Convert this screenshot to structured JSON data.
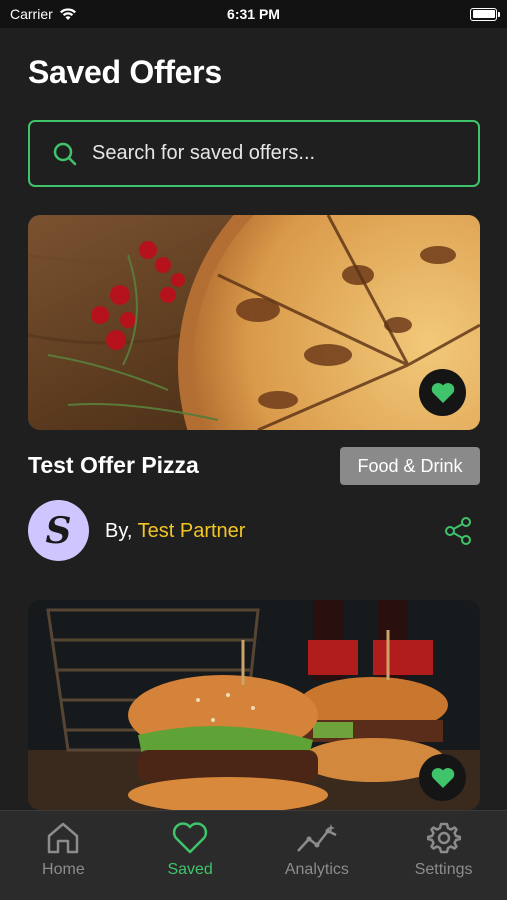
{
  "status_bar": {
    "carrier": "Carrier",
    "time": "6:31 PM"
  },
  "page": {
    "title": "Saved Offers"
  },
  "search": {
    "placeholder": "Search for saved offers..."
  },
  "offers": [
    {
      "title": "Test Offer Pizza",
      "category": "Food & Drink",
      "partner_prefix": "By,",
      "partner_name": "Test Partner",
      "partner_initial": "S",
      "favorited": true
    },
    {
      "favorited": true
    }
  ],
  "tabs": [
    {
      "label": "Home",
      "icon": "home-icon",
      "active": false
    },
    {
      "label": "Saved",
      "icon": "heart-icon",
      "active": true
    },
    {
      "label": "Analytics",
      "icon": "analytics-icon",
      "active": false
    },
    {
      "label": "Settings",
      "icon": "gear-icon",
      "active": false
    }
  ],
  "colors": {
    "accent": "#3fc46b",
    "partner": "#f3c623",
    "background": "#1f1f1f",
    "badge": "#8a8a8a"
  }
}
